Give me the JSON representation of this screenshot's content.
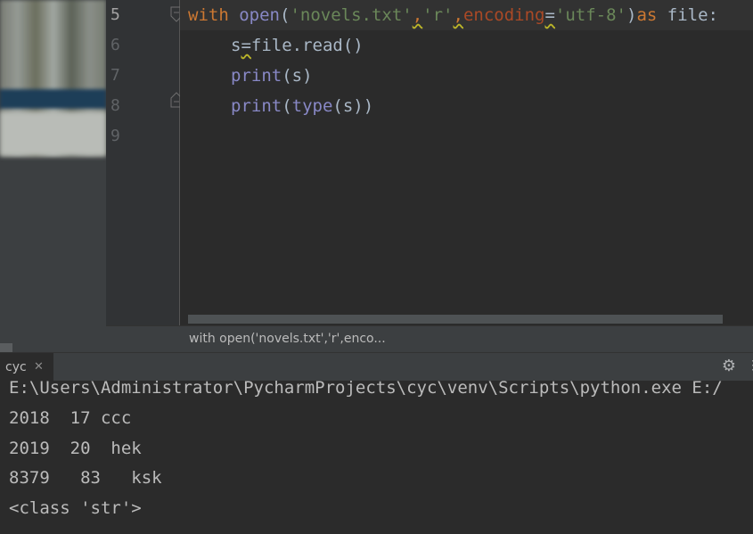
{
  "editor": {
    "line_numbers": [
      "5",
      "6",
      "7",
      "8",
      "9"
    ],
    "line5": {
      "kw_with": "with",
      "sp1": " ",
      "bi_open": "open",
      "paren_open": "(",
      "str_file": "'novels.txt'",
      "comma1": ",",
      "str_mode": "'r'",
      "comma2": ",",
      "param_encoding": "encoding",
      "eq": "=",
      "str_enc": "'utf-8'",
      "paren_close": ")",
      "kw_as": "as",
      "var_file": " file:"
    },
    "line6": {
      "var_s": "s",
      "eq": "=",
      "call": "file.read()"
    },
    "line7": {
      "bi_print": "print",
      "args": "(s)"
    },
    "line8": {
      "bi_print": "print",
      "paren_open": "(",
      "bi_type": "type",
      "args": "(s))"
    }
  },
  "breadcrumb": {
    "text": "with open('novels.txt','r',enco..."
  },
  "run": {
    "tab_label": "cyc",
    "tab_close": "✕",
    "settings_icon": "gear-icon",
    "console_lines": [
      "E:\\Users\\Administrator\\PycharmProjects\\cyc\\venv\\Scripts\\python.exe E:/",
      "2018  17 ccc",
      "2019  20  hek",
      "8379   83   ksk",
      "<class 'str'>"
    ]
  },
  "colors": {
    "keyword": "#cc7832",
    "builtin": "#8888c6",
    "string": "#6a8759",
    "default": "#a9b7c6",
    "background": "#2b2b2b"
  }
}
